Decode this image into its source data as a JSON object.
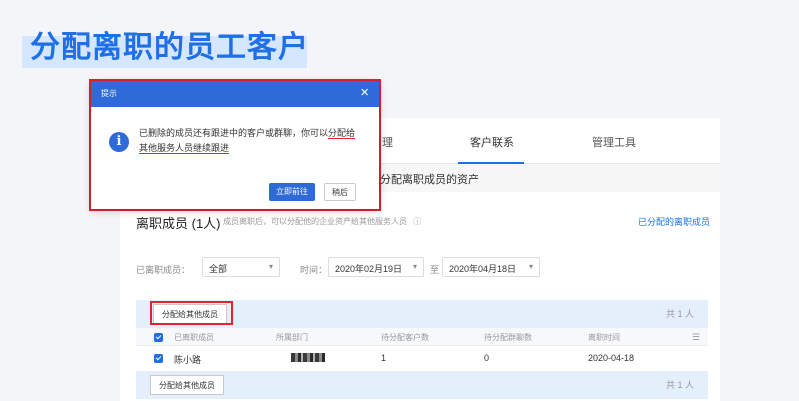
{
  "slide": {
    "title": "分配离职的员工客户"
  },
  "tabs": [
    {
      "label": "理"
    },
    {
      "label": "客户联系"
    },
    {
      "label": "管理工具"
    }
  ],
  "subheader": {
    "text": "分配离职成员的资产"
  },
  "section": {
    "title": "离职成员 (1人)",
    "description": "成员离职后，可以分配他的企业资产给其他服务人员",
    "info_icon": "question-circle-icon",
    "assigned_link": "已分配的离职成员"
  },
  "filters": {
    "member_label": "已离职成员：",
    "member_value": "全部",
    "time_label": "时间：",
    "date_from": "2020年02月19日",
    "date_sep": "至",
    "date_to": "2020年04月18日"
  },
  "bulk": {
    "assign_button": "分配给其他成员",
    "count_text": "共 1 人"
  },
  "table": {
    "headers": [
      "已离职成员",
      "所属部门",
      "待分配客户数",
      "待分配群聊数",
      "离职时间"
    ],
    "rows": [
      {
        "name": "陈小路",
        "department": "",
        "customers": "1",
        "groups": "0",
        "date": "2020-04-18"
      }
    ]
  },
  "dialog": {
    "title": "提示",
    "close_icon": "close-icon",
    "info_icon": "info-icon",
    "message_pre": "已删除的成员还有跟进中的客户或群聊，你可以",
    "message_highlight1": "分配给",
    "message_highlight2": "其他服务人员继续跟进",
    "primary_button": "立即前往",
    "secondary_button": "稍后"
  },
  "colors": {
    "accent": "#2e6ad8",
    "title_blue": "#1f6fe5",
    "highlight_red": "#e0232e"
  }
}
